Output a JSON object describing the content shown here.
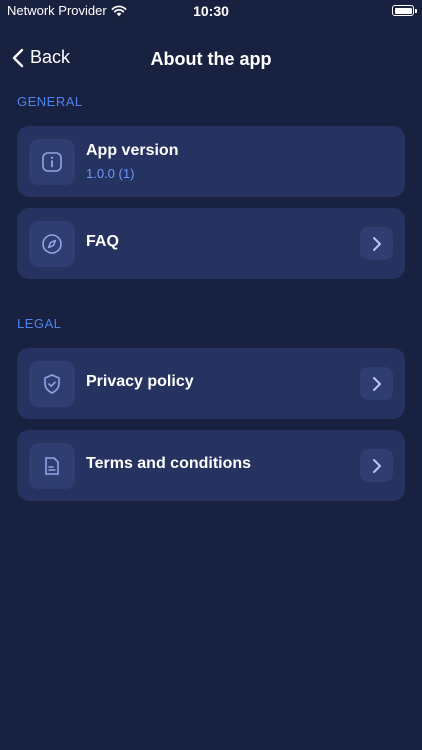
{
  "status_bar": {
    "carrier": "Network Provider",
    "time": "10:30"
  },
  "nav": {
    "back_label": "Back",
    "title": "About the app"
  },
  "sections": {
    "general": {
      "header": "GENERAL",
      "items": [
        {
          "title": "App version",
          "subtitle": "1.0.0 (1)",
          "icon": "info-icon"
        },
        {
          "title": "FAQ",
          "icon": "compass-icon"
        }
      ]
    },
    "legal": {
      "header": "LEGAL",
      "items": [
        {
          "title": "Privacy policy",
          "icon": "shield-check-icon"
        },
        {
          "title": "Terms and conditions",
          "icon": "document-icon"
        }
      ]
    }
  },
  "colors": {
    "background": "#18213f",
    "card": "#263260",
    "icon_tile": "#303d70",
    "accent": "#4f83f0",
    "subtitle": "#6f98f3",
    "icon_stroke": "#8fa4e6"
  }
}
